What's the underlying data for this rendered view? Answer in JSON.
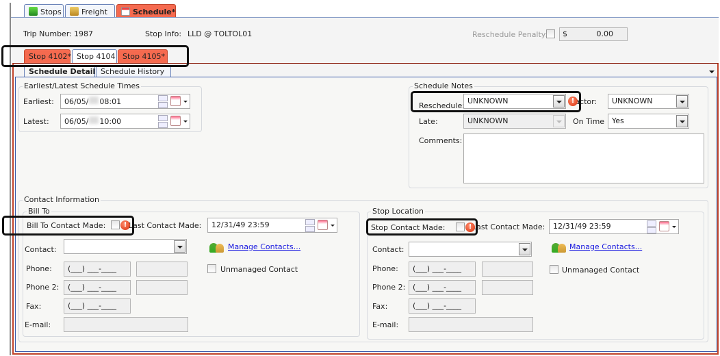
{
  "top_tabs": [
    {
      "label": "Stops",
      "icon": "green-cube-icon"
    },
    {
      "label": "Freight",
      "icon": "package-icon"
    },
    {
      "label": "Schedule*",
      "icon": "calendar-icon"
    }
  ],
  "header": {
    "trip_label": "Trip Number:",
    "trip_value": "1987",
    "stop_info_label": "Stop Info:",
    "stop_info_value": "LLD @ TOLTOL01",
    "penalty_label": "Reschedule Penalty:",
    "penalty_currency": "$",
    "penalty_value": "0.00"
  },
  "stop_tabs": [
    {
      "label": "Stop 4102*"
    },
    {
      "label": "Stop 4104"
    },
    {
      "label": "Stop 4105*"
    }
  ],
  "sub_tabs": [
    {
      "label": "Schedule Detail"
    },
    {
      "label": "Schedule History"
    }
  ],
  "times": {
    "title": "Earliest/Latest Schedule Times",
    "earliest_label": "Earliest:",
    "earliest_date": "06/05/",
    "earliest_time": "08:01",
    "latest_label": "Latest:",
    "latest_date": "06/05/",
    "latest_time": "10:00"
  },
  "notes": {
    "title": "Schedule Notes",
    "reschedule_label": "Reschedule:",
    "reschedule_value": "UNKNOWN",
    "factor_label": "Factor:",
    "factor_value": "UNKNOWN",
    "late_label": "Late:",
    "late_value": "UNKNOWN",
    "ontime_label": "On Time",
    "ontime_value": "Yes",
    "comments_label": "Comments:",
    "comments_value": ""
  },
  "contact": {
    "title": "Contact Information",
    "bill_to": {
      "title": "Bill To",
      "made_label": "Bill To Contact Made:",
      "last_label": "Last Contact Made:",
      "last_value": "12/31/49 23:59",
      "contact_label": "Contact:",
      "manage_link": "Manage Contacts...",
      "unmanaged_label": "Unmanaged Contact",
      "phone_label": "Phone:",
      "phone_value": "(___) ___-____",
      "phone2_label": "Phone 2:",
      "phone2_value": "(___) ___-____",
      "fax_label": "Fax:",
      "fax_value": "(___) ___-____",
      "email_label": "E-mail:"
    },
    "stop_location": {
      "title": "Stop Location",
      "made_label": "Stop Contact Made:",
      "last_label": "Last Contact Made:",
      "last_value": "12/31/49 23:59",
      "contact_label": "Contact:",
      "manage_link": "Manage Contacts...",
      "unmanaged_label": "Unmanaged Contact",
      "phone_label": "Phone:",
      "phone_value": "(___) ___-____",
      "phone2_label": "Phone 2:",
      "phone2_value": "(___) ___-____",
      "fax_label": "Fax:",
      "fax_value": "(___) ___-____",
      "email_label": "E-mail:"
    }
  },
  "colors": {
    "modified_tab": "#f56a4f",
    "link": "#1a1adf",
    "panel_border": "#c2452c"
  }
}
